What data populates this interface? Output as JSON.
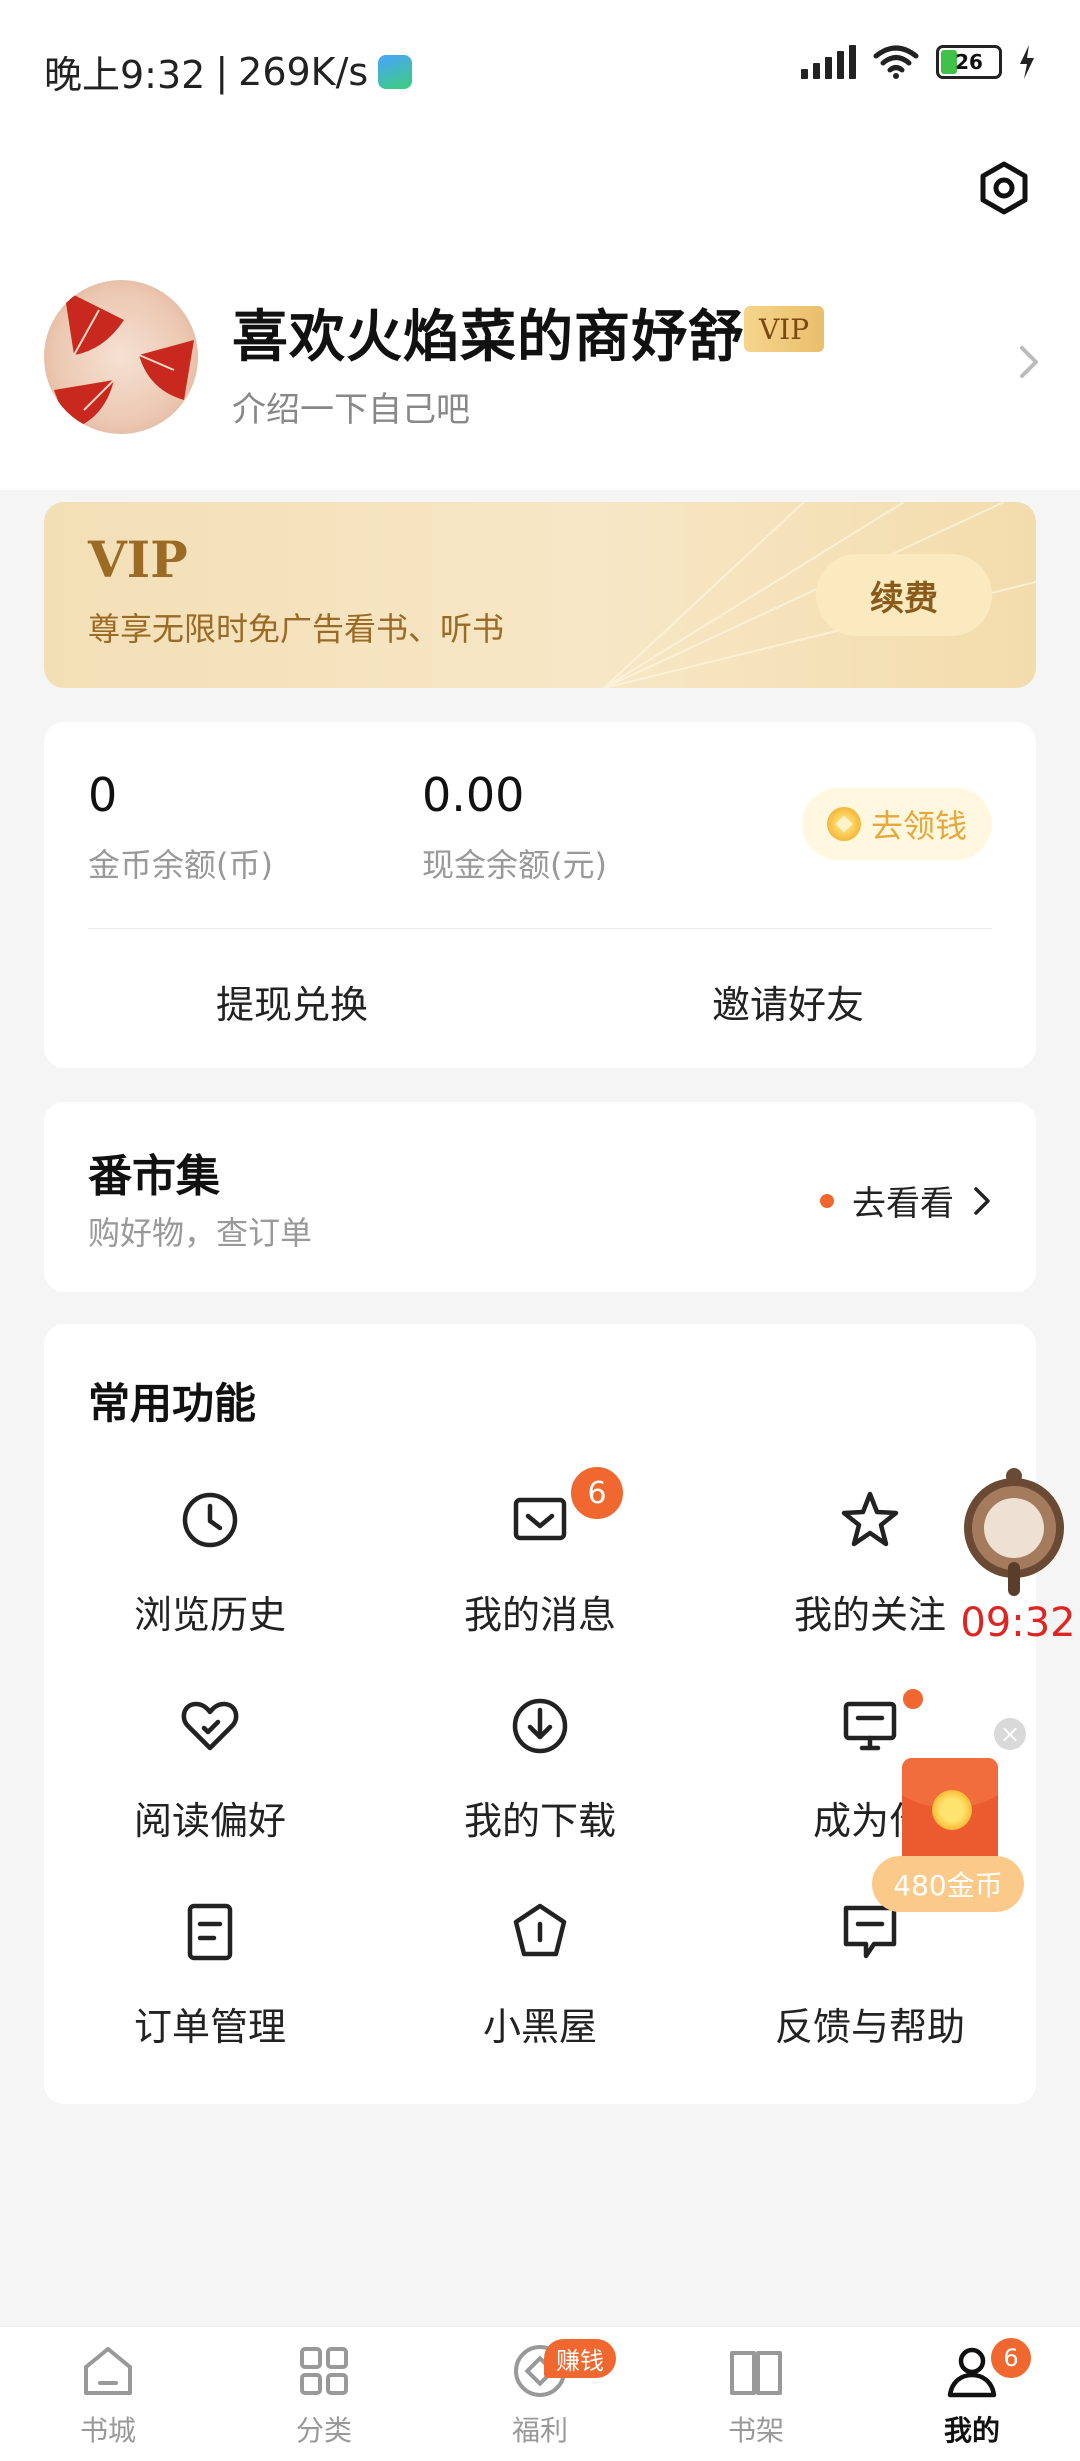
{
  "status_bar": {
    "time": "晚上9:32",
    "speed": "269K/s",
    "battery": "26"
  },
  "profile": {
    "username": "喜欢火焰菜的商妤舒",
    "vip_tag": "VIP",
    "bio": "介绍一下自己吧"
  },
  "vip_banner": {
    "title": "VIP",
    "subtitle": "尊享无限时免广告看书、听书",
    "renew_label": "续费"
  },
  "wallet": {
    "coin_balance": "0",
    "coin_label": "金币余额(币)",
    "cash_balance": "0.00",
    "cash_label": "现金余额(元)",
    "claim_label": "去领钱",
    "withdraw_label": "提现兑换",
    "invite_label": "邀请好友"
  },
  "market": {
    "title": "番市集",
    "subtitle": "购好物，查订单",
    "link_label": "去看看"
  },
  "functions": {
    "title": "常用功能",
    "items": [
      {
        "label": "浏览历史",
        "icon": "clock-icon"
      },
      {
        "label": "我的消息",
        "icon": "message-icon",
        "badge": "6"
      },
      {
        "label": "我的关注",
        "icon": "star-icon"
      },
      {
        "label": "阅读偏好",
        "icon": "heart-check-icon"
      },
      {
        "label": "我的下载",
        "icon": "download-icon"
      },
      {
        "label": "成为作",
        "icon": "monitor-icon",
        "dot": true
      },
      {
        "label": "订单管理",
        "icon": "document-icon"
      },
      {
        "label": "小黑屋",
        "icon": "pentagon-icon"
      },
      {
        "label": "反馈与帮助",
        "icon": "feedback-icon"
      }
    ]
  },
  "floating": {
    "clock_time": "09:32",
    "redpacket_label": "480金币"
  },
  "bottom_nav": {
    "items": [
      {
        "label": "书城",
        "icon": "home-icon"
      },
      {
        "label": "分类",
        "icon": "grid-icon"
      },
      {
        "label": "福利",
        "icon": "coin-icon",
        "badge": "赚钱"
      },
      {
        "label": "书架",
        "icon": "book-icon"
      },
      {
        "label": "我的",
        "icon": "person-icon",
        "badge": "6",
        "active": true
      }
    ]
  },
  "colors": {
    "accent": "#f0682f",
    "gold_text": "#9b6a24",
    "vip_banner_bg": "#f5e4bf"
  }
}
